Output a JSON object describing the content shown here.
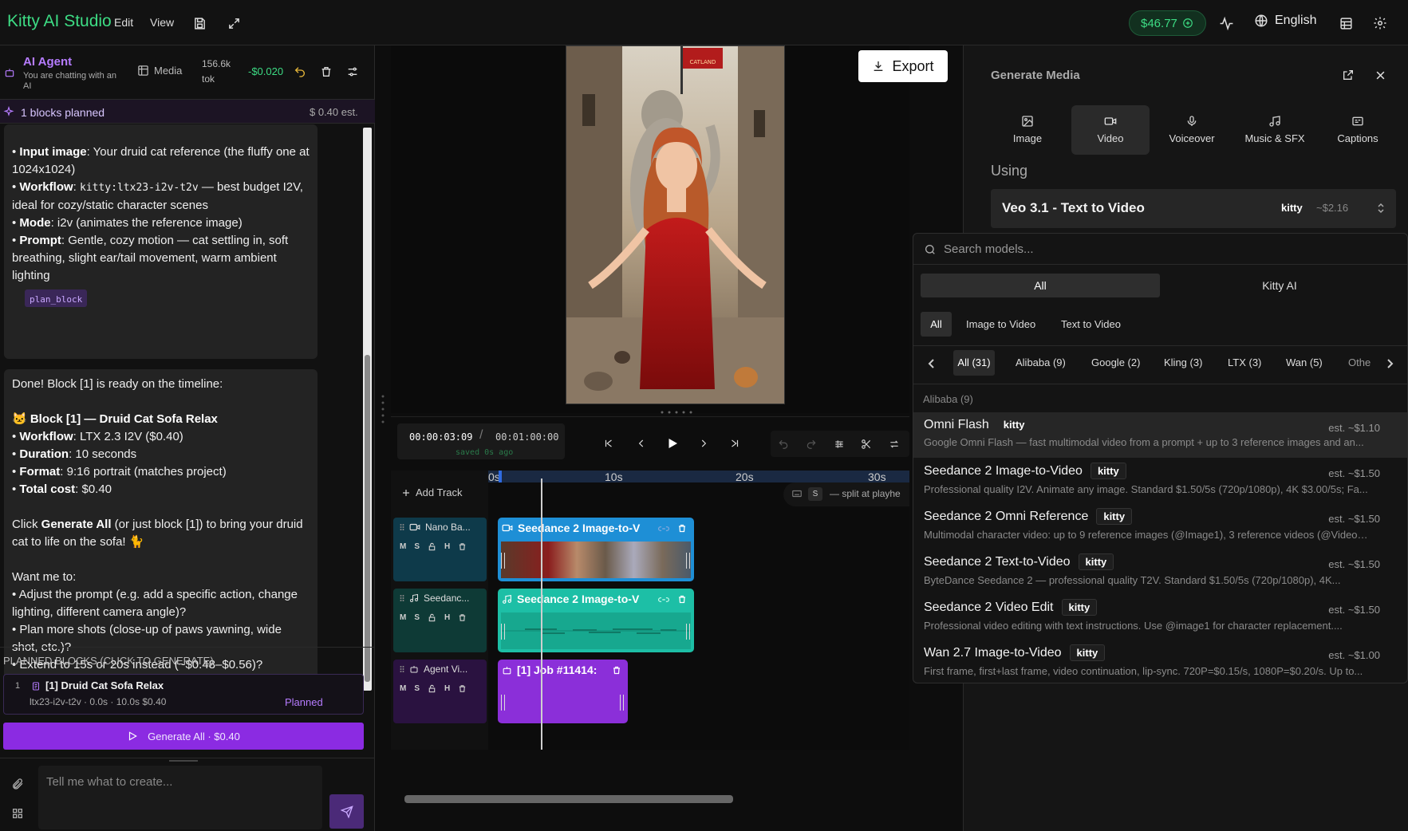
{
  "app": {
    "title": "Kitty AI Studio",
    "menu": [
      "Edit",
      "View"
    ],
    "balance": "$46.77",
    "language": "English"
  },
  "agent": {
    "title": "AI Agent",
    "subtitle": "You are chatting with an AI",
    "media_label": "Media",
    "tokens": "156.6k",
    "tokens_unit": "tok",
    "cost": "-$0.020",
    "planned_summary": "1 blocks planned",
    "planned_est": "$ 0.40 est."
  },
  "chat": {
    "msg1": [
      {
        "b": "Input image",
        "t": ": Your druid cat reference (the fluffy one at 1024x1024)"
      },
      {
        "b": "Workflow",
        "code": "kitty:ltx23-i2v-t2v",
        "t": " — best budget I2V, ideal for cozy/static character scenes"
      },
      {
        "b": "Mode",
        "t": ": i2v (animates the reference image)"
      },
      {
        "b": "Prompt",
        "t": ": Gentle, cozy motion — cat settling in, soft breathing, slight ear/tail movement, warm ambient lighting"
      }
    ],
    "plan_tag": "plan_block",
    "msg2_intro": "Done! Block [1] is ready on the timeline:",
    "msg2_block_title": "🐱 Block [1] — Druid Cat Sofa Relax",
    "msg2_details": [
      {
        "b": "Workflow",
        "t": ": LTX 2.3 I2V ($0.40)"
      },
      {
        "b": "Duration",
        "t": ": 10 seconds"
      },
      {
        "b": "Format",
        "t": ": 9:16 portrait (matches project)"
      },
      {
        "b": "Total cost",
        "t": ": $0.40"
      }
    ],
    "msg2_click_pre": "Click ",
    "msg2_click_b": "Generate All",
    "msg2_click_post": " (or just block [1]) to bring your druid cat to life on the sofa! 🐈",
    "msg2_want": "Want me to:",
    "msg2_options": [
      "Adjust the prompt (e.g. add a specific action, change lighting, different camera angle)?",
      "Plan more shots (close-up of paws yawning, wide shot, etc.)?",
      "Extend to 15s or 20s instead (~$0.48–$0.56)?"
    ]
  },
  "planned_blocks": {
    "header": "PLANNED BLOCKS (CLICK TO GENERATE)",
    "items": [
      {
        "index": "1",
        "title": "[1] Druid Cat Sofa Relax",
        "meta": "ltx23-i2v-t2v · 0.0s · 10.0s $0.40",
        "status": "Planned"
      }
    ],
    "generate_all": "Generate All · $0.40"
  },
  "composer": {
    "placeholder": "Tell me what to create..."
  },
  "preview": {
    "export_label": "Export",
    "flag_text": "CATLAND"
  },
  "transport": {
    "current": "00:00:03:09",
    "separator": "/",
    "total": "00:01:00:00",
    "saved": "saved 0s ago"
  },
  "timeline": {
    "add_track": "Add Track",
    "ruler": [
      "0s",
      "10s",
      "20s",
      "30s"
    ],
    "shortcut_key": "S",
    "shortcut_text": "— split at playhe",
    "tracks": [
      {
        "name": "Nano Ba...",
        "clip": "Seedance 2 Image-to-V",
        "color": "#1e8fd6"
      },
      {
        "name": "Seedanc...",
        "clip": "Seedance 2 Image-to-V",
        "color": "#1dbfa6"
      },
      {
        "name": "Agent Vi...",
        "clip": "[1] Job #11414:",
        "color": "#8b2fd9"
      }
    ],
    "track_buttons": [
      "M",
      "S",
      "H"
    ]
  },
  "generate_media": {
    "title": "Generate Media",
    "tabs": [
      "Image",
      "Video",
      "Voiceover",
      "Music & SFX",
      "Captions"
    ],
    "using_label": "Using",
    "selected_model": "Veo 3.1 - Text to Video",
    "selected_badge": "kitty",
    "selected_price": "~$2.16"
  },
  "model_picker": {
    "search_placeholder": "Search models...",
    "scope_tabs": [
      "All",
      "Kitty AI"
    ],
    "type_tabs": [
      "All",
      "Image to Video",
      "Text to Video"
    ],
    "providers": [
      "All (31)",
      "Alibaba (9)",
      "Google (2)",
      "Kling (3)",
      "LTX (3)",
      "Wan (5)",
      "Othe"
    ],
    "group_label": "Alibaba (9)",
    "models": [
      {
        "name": "Omni Flash",
        "badge": "kitty",
        "price": "est. ~$1.10",
        "desc": "Google Omni Flash — fast multimodal video from a prompt + up to 3 reference images and an..."
      },
      {
        "name": "Seedance 2 Image-to-Video",
        "badge": "kitty",
        "price": "est. ~$1.50",
        "desc": "Professional quality I2V. Animate any image. Standard $1.50/5s (720p/1080p), 4K $3.00/5s; Fa..."
      },
      {
        "name": "Seedance 2 Omni Reference",
        "badge": "kitty",
        "price": "est. ~$1.50",
        "desc": "Multimodal character video: up to 9 reference images (@Image1), 3 reference videos (@Video1..."
      },
      {
        "name": "Seedance 2 Text-to-Video",
        "badge": "kitty",
        "price": "est. ~$1.50",
        "desc": "ByteDance Seedance 2 — professional quality T2V. Standard $1.50/5s (720p/1080p), 4K..."
      },
      {
        "name": "Seedance 2 Video Edit",
        "badge": "kitty",
        "price": "est. ~$1.50",
        "desc": "Professional video editing with text instructions. Use @image1 for character replacement...."
      },
      {
        "name": "Wan 2.7 Image-to-Video",
        "badge": "kitty",
        "price": "est. ~$1.00",
        "desc": "First frame, first+last frame, video continuation, lip-sync. 720P=$0.15/s, 1080P=$0.20/s. Up to..."
      }
    ]
  }
}
